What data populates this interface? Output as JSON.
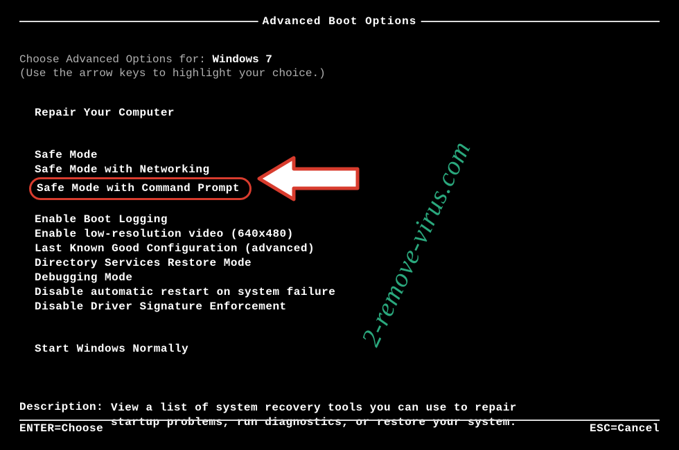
{
  "title": "Advanced Boot Options",
  "choose_prefix": "Choose Advanced Options for: ",
  "os_name": "Windows 7",
  "hint": "(Use the arrow keys to highlight your choice.)",
  "menu": {
    "group1": [
      "Repair Your Computer"
    ],
    "group2": [
      "Safe Mode",
      "Safe Mode with Networking",
      "Safe Mode with Command Prompt"
    ],
    "group3": [
      "Enable Boot Logging",
      "Enable low-resolution video (640x480)",
      "Last Known Good Configuration (advanced)",
      "Directory Services Restore Mode",
      "Debugging Mode",
      "Disable automatic restart on system failure",
      "Disable Driver Signature Enforcement"
    ],
    "group4": [
      "Start Windows Normally"
    ],
    "highlighted_index": 2
  },
  "description": {
    "label": "Description:",
    "text_line1": "View a list of system recovery tools you can use to repair",
    "text_line2": "startup problems, run diagnostics, or restore your system."
  },
  "footer": {
    "left": "ENTER=Choose",
    "right": "ESC=Cancel"
  },
  "watermark": "2-remove-virus.com"
}
